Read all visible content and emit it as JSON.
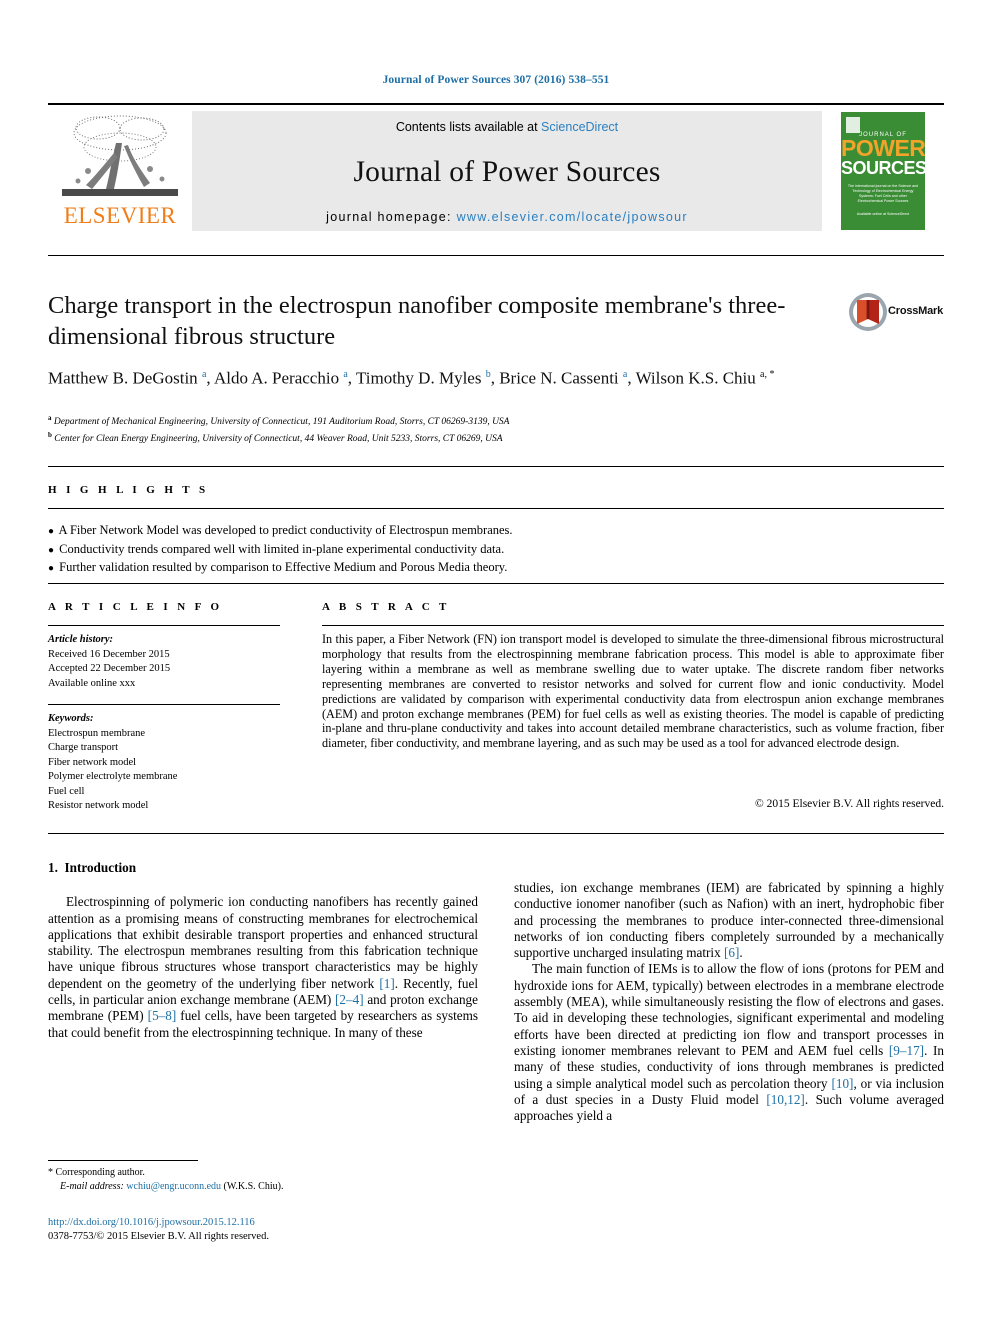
{
  "running_head": "Journal of Power Sources 307 (2016) 538–551",
  "masthead": {
    "contents_prefix": "Contents lists available at ",
    "sciencedirect": "ScienceDirect",
    "journal_title": "Journal of Power Sources",
    "homepage_prefix": "journal homepage: ",
    "homepage_url": "www.elsevier.com/locate/jpowsour",
    "publisher": "ELSEVIER",
    "link_color": "#2b7fc0",
    "publisher_color": "#ef7d1a"
  },
  "cover": {
    "journal_of": "JOURNAL OF",
    "power": "POWER",
    "sources": "SOURCES",
    "subtitle": "The international journal on the Science and Technology of Electrochemical Energy Systems: Fuel Cells and other Electrochemical Power Sources",
    "footer": "Available online at\nScienceDirect",
    "bg_color": "#3a8c35",
    "power_color": "#f2a42a"
  },
  "article": {
    "title": "Charge transport in the electrospun nanofiber composite membrane's three-dimensional fibrous structure",
    "authors": [
      {
        "name": "Matthew B. DeGostin",
        "sup": "a",
        "sep": ", "
      },
      {
        "name": "Aldo A. Peracchio",
        "sup": "a",
        "sep": ", "
      },
      {
        "name": "Timothy D. Myles",
        "sup": "b",
        "sep": ", "
      },
      {
        "name": "Brice N. Cassenti",
        "sup": "a",
        "sep": ", "
      },
      {
        "name": "Wilson K.S. Chiu",
        "sup": "a, *",
        "sep": ""
      }
    ],
    "affiliations": [
      {
        "marker": "a",
        "text": "Department of Mechanical Engineering, University of Connecticut, 191 Auditorium Road, Storrs, CT 06269-3139, USA"
      },
      {
        "marker": "b",
        "text": "Center for Clean Energy Engineering, University of Connecticut, 44 Weaver Road, Unit 5233, Storrs, CT 06269, USA"
      }
    ],
    "crossmark_label": "CrossMark"
  },
  "highlights": {
    "label": "H I G H L I G H T S",
    "items": [
      "A Fiber Network Model was developed to predict conductivity of Electrospun membranes.",
      "Conductivity trends compared well with limited in-plane experimental conductivity data.",
      "Further validation resulted by comparison to Effective Medium and Porous Media theory."
    ]
  },
  "article_info": {
    "label": "A R T I C L E   I N F O",
    "history_heading": "Article history:",
    "history": [
      "Received 16 December 2015",
      "Accepted 22 December 2015",
      "Available online xxx"
    ],
    "keywords_heading": "Keywords:",
    "keywords": [
      "Electrospun membrane",
      "Charge transport",
      "Fiber network model",
      "Polymer electrolyte membrane",
      "Fuel cell",
      "Resistor network model"
    ]
  },
  "abstract": {
    "label": "A B S T R A C T",
    "text": "In this paper, a Fiber Network (FN) ion transport model is developed to simulate the three-dimensional fibrous microstructural morphology that results from the electrospinning membrane fabrication process. This model is able to approximate fiber layering within a membrane as well as membrane swelling due to water uptake. The discrete random fiber networks representing membranes are converted to resistor networks and solved for current flow and ionic conductivity. Model predictions are validated by comparison with experimental conductivity data from electrospun anion exchange membranes (AEM) and proton exchange membranes (PEM) for fuel cells as well as existing theories. The model is capable of predicting in-plane and thru-plane conductivity and takes into account detailed membrane characteristics, such as volume fraction, fiber diameter, fiber conductivity, and membrane layering, and as such may be used as a tool for advanced electrode design.",
    "copyright": "© 2015 Elsevier B.V. All rights reserved."
  },
  "body": {
    "section_number": "1.",
    "section_title": "Introduction",
    "left_paragraph_parts": [
      {
        "t": "Electrospinning of polymeric ion conducting nanofibers has recently gained attention as a promising means of constructing membranes for electrochemical applications that exhibit desirable transport properties and enhanced structural stability. The electrospun membranes resulting from this fabrication technique have unique fibrous structures whose transport characteristics may be highly dependent on the geometry of the underlying fiber network ",
        "ref": false
      },
      {
        "t": "[1]",
        "ref": true
      },
      {
        "t": ". Recently, fuel cells, in particular anion exchange membrane (AEM) ",
        "ref": false
      },
      {
        "t": "[2–4]",
        "ref": true
      },
      {
        "t": " and proton exchange membrane (PEM) ",
        "ref": false
      },
      {
        "t": "[5–8]",
        "ref": true
      },
      {
        "t": " fuel cells, have been targeted by researchers as systems that could benefit from the electrospinning technique. In many of these",
        "ref": false
      }
    ],
    "right_paragraph1_parts": [
      {
        "t": "studies, ion exchange membranes (IEM) are fabricated by spinning a highly conductive ionomer nanofiber (such as Nafion) with an inert, hydrophobic fiber and processing the membranes to produce inter-connected three-dimensional networks of ion conducting fibers completely surrounded by a mechanically supportive uncharged insulating matrix ",
        "ref": false
      },
      {
        "t": "[6]",
        "ref": true
      },
      {
        "t": ".",
        "ref": false
      }
    ],
    "right_paragraph2_parts": [
      {
        "t": "The main function of IEMs is to allow the flow of ions (protons for PEM and hydroxide ions for AEM, typically) between electrodes in a membrane electrode assembly (MEA), while simultaneously resisting the flow of electrons and gases. To aid in developing these technologies, significant experimental and modeling efforts have been directed at predicting ion flow and transport processes in existing ionomer membranes relevant to PEM and AEM fuel cells ",
        "ref": false
      },
      {
        "t": "[9–17]",
        "ref": true
      },
      {
        "t": ". In many of these studies, conductivity of ions through membranes is predicted using a simple analytical model such as percolation theory ",
        "ref": false
      },
      {
        "t": "[10]",
        "ref": true
      },
      {
        "t": ", or via inclusion of a dust species in a Dusty Fluid model ",
        "ref": false
      },
      {
        "t": "[10,12]",
        "ref": true
      },
      {
        "t": ". Such volume averaged approaches yield a",
        "ref": false
      }
    ]
  },
  "footer": {
    "corresponding_marker": "*",
    "corresponding_text": "Corresponding author.",
    "email_label": "E-mail address:",
    "email": "wchiu@engr.uconn.edu",
    "email_owner": "(W.K.S. Chiu).",
    "doi": "http://dx.doi.org/10.1016/j.jpowsour.2015.12.116",
    "issn_line": "0378-7753/© 2015 Elsevier B.V. All rights reserved."
  }
}
